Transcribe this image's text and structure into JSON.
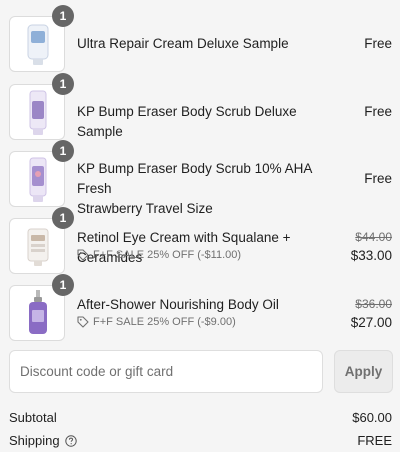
{
  "items": [
    {
      "name": "Ultra Repair Cream Deluxe Sample",
      "quantity": "1",
      "price": "Free",
      "product_color": "#8fb0d8"
    },
    {
      "name": "KP Bump Eraser Body Scrub Deluxe Sample",
      "quantity": "1",
      "price": "Free",
      "product_color": "#9b86c6"
    },
    {
      "name_line1": "KP Bump Eraser Body Scrub 10% AHA Fresh",
      "name_line2": "Strawberry Travel Size",
      "quantity": "1",
      "price": "Free",
      "product_color": "#a58fcf"
    },
    {
      "name": "Retinol Eye Cream with Squalane + Ceramides",
      "quantity": "1",
      "original_price": "$44.00",
      "price": "$33.00",
      "discount": "F+F SALE 25% OFF (-$11.00)",
      "product_color": "#d9d2cc"
    },
    {
      "name": "After-Shower Nourishing Body Oil",
      "quantity": "1",
      "original_price": "$36.00",
      "price": "$27.00",
      "discount": "F+F SALE 25% OFF (-$9.00)",
      "product_color": "#8a6cc4"
    }
  ],
  "discount_field": {
    "placeholder": "Discount code or gift card",
    "value": ""
  },
  "apply_label": "Apply",
  "summary": {
    "subtotal_label": "Subtotal",
    "subtotal_value": "$60.00",
    "shipping_label": "Shipping",
    "shipping_value": "FREE"
  },
  "icons": {
    "discount_tag": "tag-icon",
    "shipping_help": "help-circle-icon"
  }
}
